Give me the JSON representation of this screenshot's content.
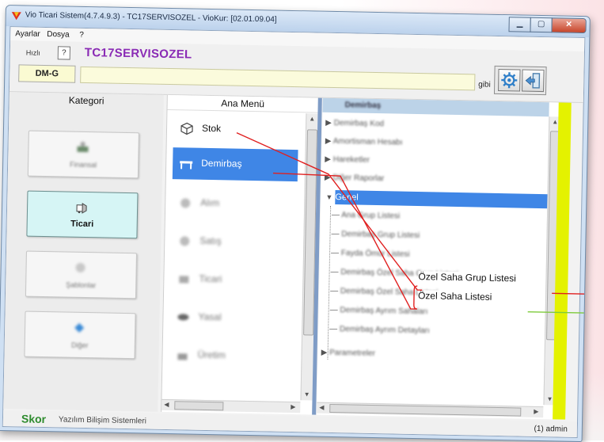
{
  "window": {
    "title": "Vio Ticari Sistem(4.7.4.9.3)  - TC17SERVISOZEL - VioKur: [02.01.09.04]",
    "controls": [
      "minimize",
      "maximize",
      "close"
    ]
  },
  "menu": {
    "items": [
      "Ayarlar",
      "Dosya",
      "?"
    ]
  },
  "topbar": {
    "hizli_label": "Hızlı",
    "help_label": "?",
    "company_code": "TC17SERVISOZEL",
    "screen_code": "DM-G",
    "search_value": "",
    "gibi_label": "gibi",
    "tools": [
      "gear-icon",
      "exit-icon"
    ]
  },
  "kategori": {
    "header": "Kategori",
    "items": [
      "Finansal",
      "Ticari",
      "Şablonlar",
      "Diğer"
    ],
    "active": "Ticari"
  },
  "ana_menu": {
    "header": "Ana Menü",
    "items": [
      "Stok",
      "Demirbaş",
      "Alım",
      "Satış",
      "Ticari",
      "Yasal",
      "Üretim"
    ],
    "selected": "Demirbaş"
  },
  "demirbas": {
    "header": "Demirbaş",
    "tree": [
      {
        "label": "Demirbaş Kod",
        "level": 0,
        "expand": "▶"
      },
      {
        "label": "Amortisman Hesabı",
        "level": 0,
        "expand": "▶"
      },
      {
        "label": "Hareketler",
        "level": 0,
        "expand": "▶"
      },
      {
        "label": "Diğer Raporlar",
        "level": 0,
        "expand": "▶"
      },
      {
        "label": "Genel",
        "level": 0,
        "expand": "▼",
        "selected": true
      },
      {
        "label": "Ana Grup Listesi",
        "level": 1
      },
      {
        "label": "Demirbaş Grup Listesi",
        "level": 1
      },
      {
        "label": "Fayda Ömür Listesi",
        "level": 1
      },
      {
        "label": "Demirbaş Özel Saha Grup Listesi",
        "level": 1
      },
      {
        "label": "Demirbaş Özel Saha Listesi",
        "level": 1
      },
      {
        "label": "Demirbaş Ayrım Sahaları",
        "level": 1
      },
      {
        "label": "Demirbaş Ayrım Detayları",
        "level": 1
      },
      {
        "label": "Parametreler",
        "level": 0,
        "expand": "▶"
      }
    ],
    "callouts": [
      "Özel Saha Grup Listesi",
      "Özel Saha Listesi"
    ]
  },
  "annotation_colors": {
    "red": "#e02020",
    "green": "#7ecb3c"
  },
  "status": {
    "brand": "Skor",
    "company": "Yazılım Bilişim Sistemleri",
    "user": "(1) admin"
  }
}
